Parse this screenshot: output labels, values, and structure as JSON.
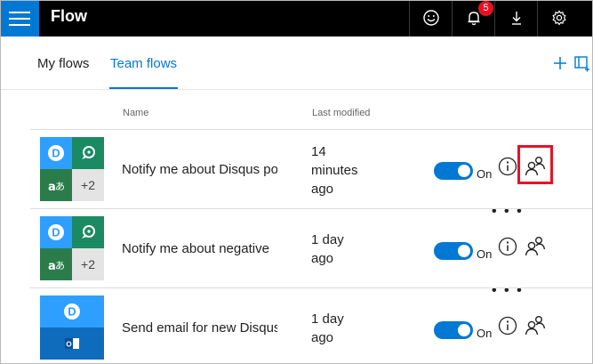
{
  "header": {
    "app_title": "Flow",
    "icons": [
      "hamburger-menu-icon",
      "smiley-feedback-icon",
      "bell-notification-icon",
      "download-icon",
      "gear-icon"
    ],
    "notification_count": "5",
    "accent": "#0078d4",
    "bar_color": "#000000"
  },
  "tabs": [
    {
      "label": "My flows",
      "active": false
    },
    {
      "label": "Team flows",
      "active": true
    }
  ],
  "toolbar": {
    "icons": [
      "plus-icon",
      "layout-icon"
    ]
  },
  "columns": {
    "name": "Name",
    "last_modified": "Last modified"
  },
  "flows": [
    {
      "name": "Notify me about Disqus po",
      "modified_lines": [
        "14",
        "minutes",
        "ago"
      ],
      "connectors": [
        "disqus",
        "sentiment",
        "translator"
      ],
      "connectors_more": "+2",
      "enabled": true,
      "state_label": "On",
      "highlight_share": true
    },
    {
      "name": "Notify me about negative",
      "modified_lines": [
        "1 day",
        "ago"
      ],
      "connectors": [
        "disqus",
        "sentiment",
        "translator"
      ],
      "connectors_more": "+2",
      "enabled": true,
      "state_label": "On",
      "highlight_share": false
    },
    {
      "name": "Send email for new Disqus",
      "modified_lines": [
        "1 day",
        "ago"
      ],
      "connectors": [
        "disqus",
        "outlook"
      ],
      "connectors_more": "",
      "enabled": true,
      "state_label": "On",
      "highlight_share": false
    }
  ],
  "colors": {
    "disqus": "#2e9fff",
    "sentiment": "#1a8a63",
    "translator": "#2a7d4a",
    "outlook": "#0f6cbd",
    "highlight": "#e81123"
  }
}
